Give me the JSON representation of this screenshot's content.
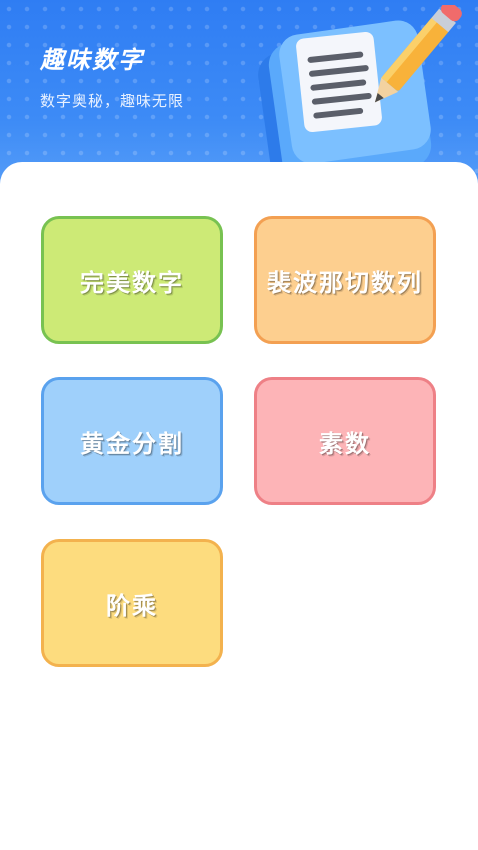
{
  "header": {
    "title": "趣味数字",
    "subtitle": "数字奥秘，趣味无限"
  },
  "cards": [
    {
      "label": "完美数字"
    },
    {
      "label": "裴波那切数列"
    },
    {
      "label": "黄金分割"
    },
    {
      "label": "素数"
    },
    {
      "label": "阶乘"
    }
  ],
  "colors": {
    "header_blue": "#2f7df3",
    "green": "#cdea76",
    "orange": "#fdcf8f",
    "blue": "#9fd0fb",
    "pink": "#fdb4b7",
    "yellow": "#fddc7e"
  }
}
